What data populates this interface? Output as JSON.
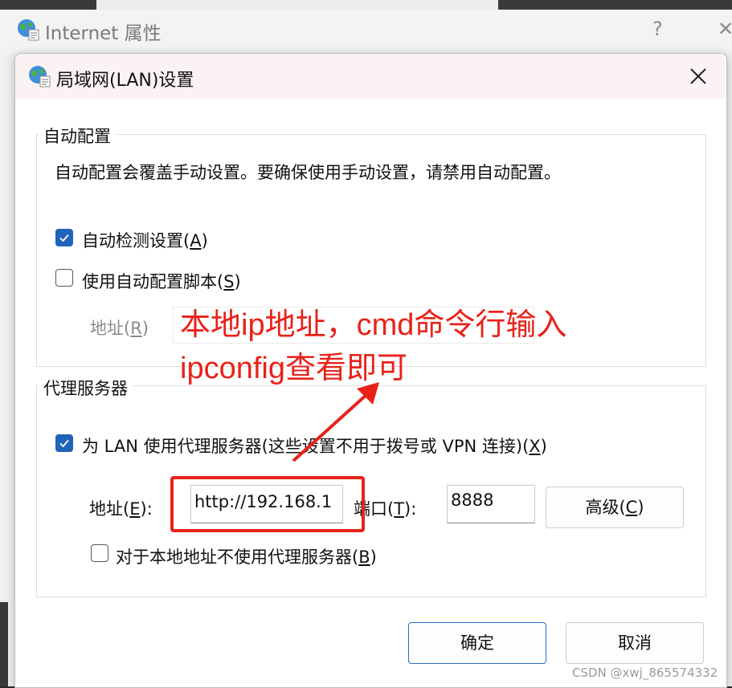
{
  "background_window": {
    "title": "Internet 属性",
    "help_label": "?",
    "close_label": "✕"
  },
  "dialog": {
    "title": "局域网(LAN)设置",
    "close_label": "✕"
  },
  "auto_config": {
    "legend": "自动配置",
    "description": "自动配置会覆盖手动设置。要确保使用手动设置，请禁用自动配置。",
    "auto_detect": {
      "label_prefix": "自动检测设置(",
      "mnemonic": "A",
      "label_suffix": ")",
      "checked": true
    },
    "use_script": {
      "label_prefix": "使用自动配置脚本(",
      "mnemonic": "S",
      "label_suffix": ")",
      "checked": false
    },
    "address": {
      "label_prefix": "地址(",
      "mnemonic": "R",
      "label_suffix": ")",
      "value": "",
      "enabled": false
    }
  },
  "proxy": {
    "legend": "代理服务器",
    "use_proxy": {
      "label_prefix": "为 LAN 使用代理服务器(这些设置不用于拨号或 VPN 连接)(",
      "mnemonic": "X",
      "label_suffix": ")",
      "checked": true
    },
    "address": {
      "label_prefix": "地址(",
      "mnemonic": "E",
      "label_suffix": "):",
      "value": "http://192.168.1"
    },
    "port": {
      "label_prefix": "端口(",
      "mnemonic": "T",
      "label_suffix": "):",
      "value": "8888"
    },
    "advanced_button": {
      "label_prefix": "高级(",
      "mnemonic": "C",
      "label_suffix": ")"
    },
    "bypass_local": {
      "label_prefix": "对于本地地址不使用代理服务器(",
      "mnemonic": "B",
      "label_suffix": ")",
      "checked": false
    }
  },
  "buttons": {
    "ok": "确定",
    "cancel": "取消"
  },
  "annotation": {
    "line1": "本地ip地址，cmd命令行输入",
    "line2": "ipconfig查看即可",
    "color": "#e8221a"
  },
  "watermark": "CSDN @xwj_865574332",
  "colors": {
    "accent": "#1f64b8",
    "annotation_red": "#e8221a"
  }
}
